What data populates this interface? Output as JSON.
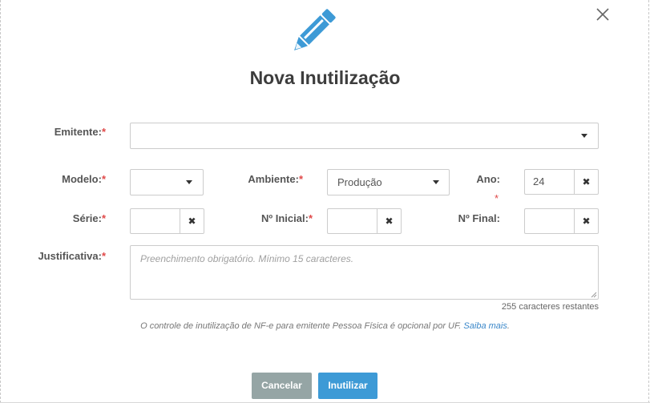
{
  "dialog": {
    "title": "Nova Inutilização",
    "close_icon": "close-icon",
    "header_icon": "pencil-icon"
  },
  "form": {
    "emitente": {
      "label": "Emitente:",
      "required_mark": "*",
      "value": ""
    },
    "modelo": {
      "label": "Modelo:",
      "required_mark": "*",
      "value": ""
    },
    "ambiente": {
      "label": "Ambiente:",
      "required_mark": "*",
      "value": "Produção"
    },
    "ano": {
      "label": "Ano:",
      "required_mark": "*",
      "value": "24"
    },
    "serie": {
      "label": "Série:",
      "required_mark": "*",
      "value": ""
    },
    "n_inicial": {
      "label": "Nº Inicial:",
      "required_mark": "*",
      "value": ""
    },
    "n_final": {
      "label": "Nº Final:",
      "value": ""
    },
    "justificativa": {
      "label": "Justificativa:",
      "required_mark": "*",
      "placeholder": "Preenchimento obrigatório. Mínimo 15 caracteres.",
      "counter": "255 caracteres restantes"
    },
    "clear_glyph": "✖"
  },
  "note": {
    "text": "O controle de inutilização de NF-e para emitente Pessoa Física é opcional por UF.",
    "link": "Saiba mais",
    "suffix": "."
  },
  "buttons": {
    "cancel": "Cancelar",
    "submit": "Inutilizar"
  },
  "colors": {
    "required": "#e04848",
    "accent": "#3d9ad6",
    "cancel": "#95a5a5",
    "link": "#3a87c9"
  }
}
